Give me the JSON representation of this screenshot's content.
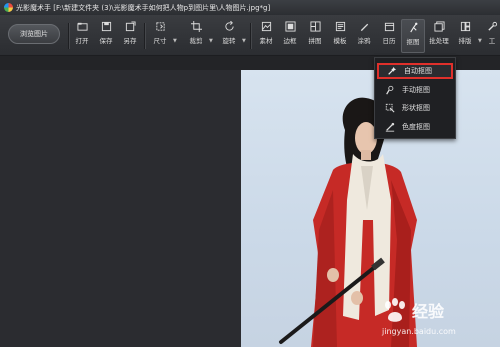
{
  "window": {
    "title": "光影魔术手 [F:\\新建文件夹 (3)\\光影魔术手如何把人物p到图片里\\人物图片.jpg*g]"
  },
  "toolbar": {
    "browse_label": "浏览图片",
    "tools": [
      {
        "label": "打开",
        "icon": "open-icon"
      },
      {
        "label": "保存",
        "icon": "save-icon"
      },
      {
        "label": "另存",
        "icon": "save-as-icon"
      },
      {
        "label": "尺寸",
        "icon": "resize-icon"
      },
      {
        "label": "裁剪",
        "icon": "crop-icon"
      },
      {
        "label": "旋转",
        "icon": "rotate-icon"
      },
      {
        "label": "素材",
        "icon": "material-icon"
      },
      {
        "label": "边框",
        "icon": "border-icon"
      },
      {
        "label": "拼图",
        "icon": "collage-icon"
      },
      {
        "label": "模板",
        "icon": "template-icon"
      },
      {
        "label": "涂鸦",
        "icon": "doodle-icon"
      },
      {
        "label": "日历",
        "icon": "calendar-icon"
      },
      {
        "label": "抠图",
        "icon": "cutout-icon"
      },
      {
        "label": "批处理",
        "icon": "batch-icon"
      },
      {
        "label": "排版",
        "icon": "layout-icon"
      },
      {
        "label": "工",
        "icon": "tools-icon"
      }
    ]
  },
  "cutout_menu": {
    "items": [
      {
        "label": "自动抠图",
        "icon": "auto-cutout-icon",
        "selected": true
      },
      {
        "label": "手动抠图",
        "icon": "manual-cutout-icon",
        "selected": false
      },
      {
        "label": "形状抠图",
        "icon": "shape-cutout-icon",
        "selected": false
      },
      {
        "label": "色度抠图",
        "icon": "chroma-cutout-icon",
        "selected": false
      }
    ]
  },
  "watermark": {
    "brand": "经验",
    "site": "jingyan.baidu.com"
  },
  "colors": {
    "highlight": "#e0302b",
    "robe_red": "#c62a26",
    "background": "#2a2b2e"
  }
}
